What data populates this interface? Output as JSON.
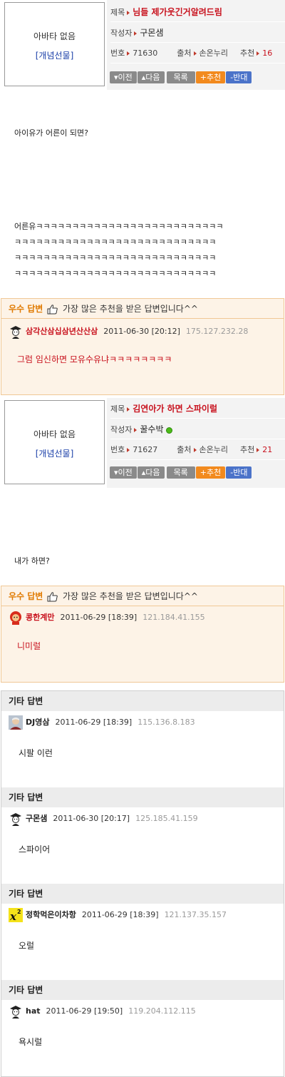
{
  "posts": [
    {
      "avatar": {
        "no_avatar": "아바타 없음",
        "gift": "[개념선물]"
      },
      "title_label": "제목",
      "title": "님들 제가웃긴거알려드림",
      "author_label": "작성자",
      "author": "구몬샘",
      "number_label": "번호",
      "number": "71630",
      "source_label": "출처",
      "source": "손온누리",
      "recommend_label": "추천",
      "recommend": "16",
      "buttons": {
        "prev": "▾이전",
        "next": "▴다음",
        "list": "목록",
        "recommend": "+추천",
        "oppose": "-반대"
      },
      "body": [
        "아이유가 어른이 되면?",
        "어른유ㅋㅋㅋㅋㅋㅋㅋㅋㅋㅋㅋㅋㅋㅋㅋㅋㅋㅋㅋㅋㅋㅋㅋㅋㅋㅋ",
        "ㅋㅋㅋㅋㅋㅋㅋㅋㅋㅋㅋㅋㅋㅋㅋㅋㅋㅋㅋㅋㅋㅋㅋㅋㅋㅋㅋㅋ",
        "ㅋㅋㅋㅋㅋㅋㅋㅋㅋㅋㅋㅋㅋㅋㅋㅋㅋㅋㅋㅋㅋㅋㅋㅋㅋㅋㅋㅋ",
        "ㅋㅋㅋㅋㅋㅋㅋㅋㅋㅋㅋㅋㅋㅋㅋㅋㅋㅋㅋㅋㅋㅋㅋㅋㅋㅋㅋㅋ"
      ],
      "best_reply": {
        "label": "우수 답변",
        "desc": "가장 많은 추천을 받은 답변입니다^^",
        "user": "삼각산삼십삼년산산삼",
        "user_color": "#c8111d",
        "date": "2011-06-30 [20:12]",
        "ip": "175.127.232.28",
        "text": "그럼 임신하면 모유수유냐ㅋㅋㅋㅋㅋㅋㅋㅋ",
        "icon": "scholar-icon"
      }
    },
    {
      "avatar": {
        "no_avatar": "아바타 없음",
        "gift": "[개념선물]"
      },
      "title_label": "제목",
      "title": "김연아가 하면 스파이럴",
      "author_label": "작성자",
      "author": "꿀수박",
      "number_label": "번호",
      "number": "71627",
      "source_label": "출처",
      "source": "손온누리",
      "recommend_label": "추천",
      "recommend": "21",
      "buttons": {
        "prev": "▾이전",
        "next": "▴다음",
        "list": "목록",
        "recommend": "+추천",
        "oppose": "-반대"
      },
      "body": [
        "내가 하면?"
      ],
      "best_reply": {
        "label": "우수 답변",
        "desc": "가장 많은 추천을 받은 답변입니다^^",
        "user": "콩한계만",
        "user_color": "#c8111d",
        "date": "2011-06-29 [18:39]",
        "ip": "121.184.41.155",
        "text": "니미럴",
        "icon": "red-character-icon"
      }
    }
  ],
  "other_replies": {
    "label": "기타 답변",
    "items": [
      {
        "user": "DJ영삼",
        "date": "2011-06-29 [18:39]",
        "ip": "115.136.8.183",
        "text": "시팔 이런",
        "icon": "photo-avatar-icon"
      },
      {
        "user": "구몬샘",
        "date": "2011-06-30 [20:17]",
        "ip": "125.185.41.159",
        "text": "스파이어",
        "icon": "scholar-icon"
      },
      {
        "user": "정학먹은이차항",
        "date": "2011-06-29 [18:39]",
        "ip": "121.137.35.157",
        "text": "오럴",
        "icon": "x-squared-icon"
      },
      {
        "user": "hat",
        "date": "2011-06-29 [19:50]",
        "ip": "119.204.112.115",
        "text": "욕시럴",
        "icon": "scholar-icon"
      }
    ]
  }
}
